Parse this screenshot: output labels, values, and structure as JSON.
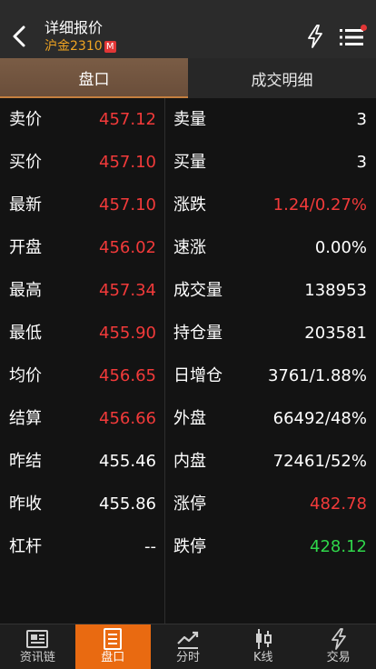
{
  "header": {
    "title": "详细报价",
    "subtitle": "沪金2310",
    "badge": "M"
  },
  "tabs": [
    {
      "label": "盘口",
      "active": true
    },
    {
      "label": "成交明细",
      "active": false
    }
  ],
  "rows": [
    {
      "l_label": "卖价",
      "l_value": "457.12",
      "l_color": "red",
      "r_label": "卖量",
      "r_value": "3",
      "r_color": "white"
    },
    {
      "l_label": "买价",
      "l_value": "457.10",
      "l_color": "red",
      "r_label": "买量",
      "r_value": "3",
      "r_color": "white"
    },
    {
      "l_label": "最新",
      "l_value": "457.10",
      "l_color": "red",
      "r_label": "涨跌",
      "r_value": "1.24/0.27%",
      "r_color": "red"
    },
    {
      "l_label": "开盘",
      "l_value": "456.02",
      "l_color": "red",
      "r_label": "速涨",
      "r_value": "0.00%",
      "r_color": "white"
    },
    {
      "l_label": "最高",
      "l_value": "457.34",
      "l_color": "red",
      "r_label": "成交量",
      "r_value": "138953",
      "r_color": "white"
    },
    {
      "l_label": "最低",
      "l_value": "455.90",
      "l_color": "red",
      "r_label": "持仓量",
      "r_value": "203581",
      "r_color": "white"
    },
    {
      "l_label": "均价",
      "l_value": "456.65",
      "l_color": "red",
      "r_label": "日增仓",
      "r_value": "3761/1.88%",
      "r_color": "white"
    },
    {
      "l_label": "结算",
      "l_value": "456.66",
      "l_color": "red",
      "r_label": "外盘",
      "r_value": "66492/48%",
      "r_color": "white"
    },
    {
      "l_label": "昨结",
      "l_value": "455.46",
      "l_color": "white",
      "r_label": "内盘",
      "r_value": "72461/52%",
      "r_color": "white"
    },
    {
      "l_label": "昨收",
      "l_value": "455.86",
      "l_color": "white",
      "r_label": "涨停",
      "r_value": "482.78",
      "r_color": "red"
    },
    {
      "l_label": "杠杆",
      "l_value": "--",
      "l_color": "white",
      "r_label": "跌停",
      "r_value": "428.12",
      "r_color": "green"
    }
  ],
  "nav": [
    {
      "label": "资讯链",
      "icon": "news-icon",
      "active": false
    },
    {
      "label": "盘口",
      "icon": "orderbook-icon",
      "active": true
    },
    {
      "label": "分时",
      "icon": "intraday-chart-icon",
      "active": false
    },
    {
      "label": "K线",
      "icon": "candlestick-icon",
      "active": false
    },
    {
      "label": "交易",
      "icon": "bolt-icon",
      "active": false
    }
  ],
  "colors": {
    "red": "#f23a3a",
    "green": "#2fd64a",
    "accent": "#e96a11",
    "subtitle": "#f0a422"
  }
}
